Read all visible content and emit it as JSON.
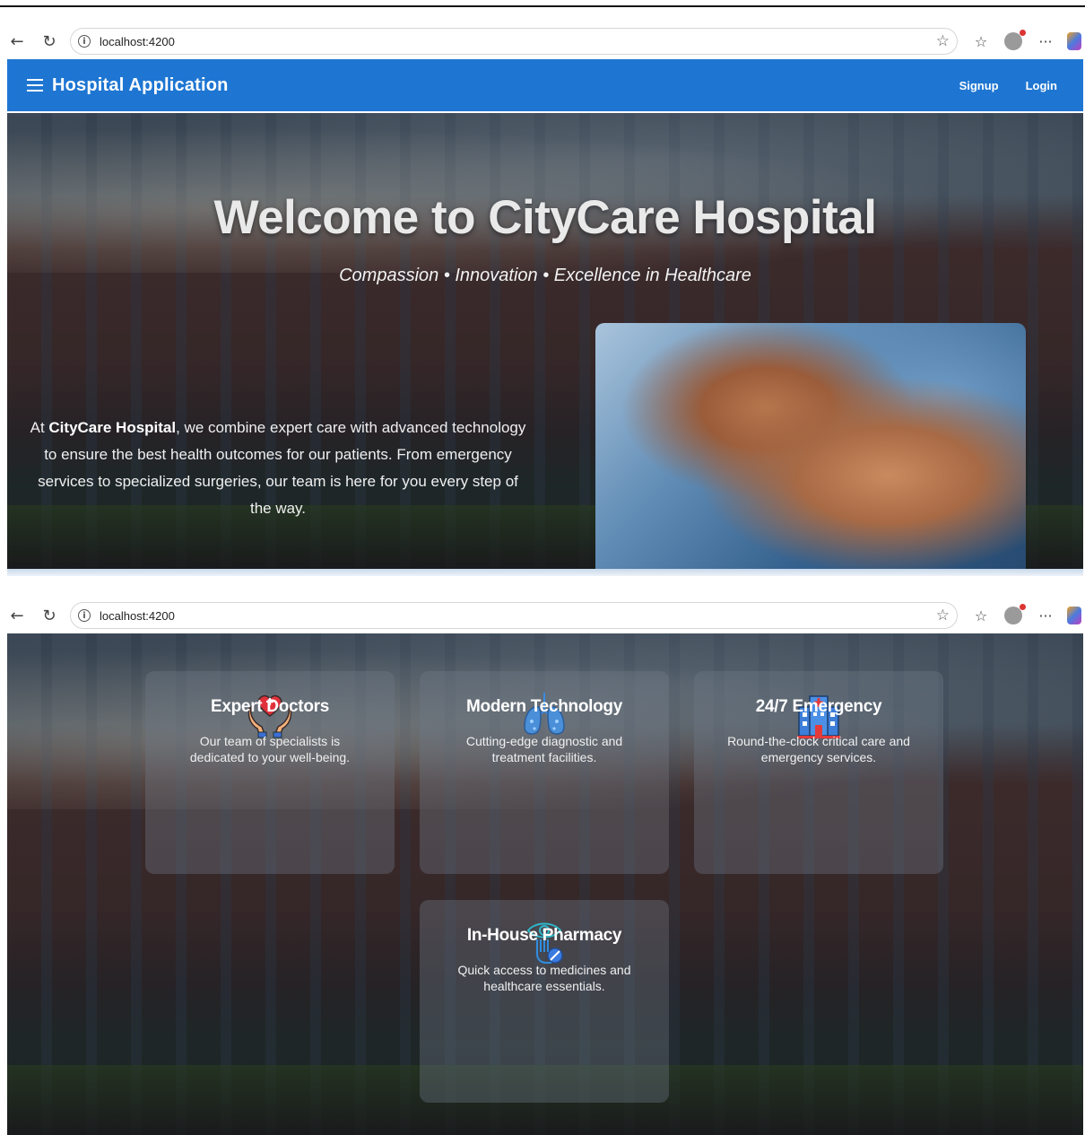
{
  "browser": {
    "url": "localhost:4200",
    "toolbar_icons": [
      "back-icon",
      "reload-icon",
      "info-icon",
      "star-icon",
      "favorites-icon",
      "profile-icon",
      "more-icon",
      "copilot-icon"
    ]
  },
  "toolbar": {
    "title": "Hospital Application",
    "signup_label": "Signup",
    "login_label": "Login",
    "color": "#1e76d2"
  },
  "hero": {
    "title": "Welcome to CityCare Hospital",
    "subtitle": "Compassion • Innovation • Excellence in Healthcare",
    "text_prefix": "At ",
    "text_bold": "CityCare Hospital",
    "text_suffix": ", we combine expert care with advanced technology to ensure the best health outcomes for our patients. From emergency services to specialized surgeries, our team is here for you every step of the way."
  },
  "features": [
    {
      "icon": "heart-hands-icon",
      "title": "Expert Doctors",
      "description": "Our team of specialists is dedicated to your well-being."
    },
    {
      "icon": "lungs-icon",
      "title": "Modern Technology",
      "description": "Cutting-edge diagnostic and treatment facilities."
    },
    {
      "icon": "hospital-building-icon",
      "title": "24/7 Emergency",
      "description": "Round-the-clock critical care and emergency services."
    },
    {
      "icon": "pharmacy-eye-icon",
      "title": "In-House Pharmacy",
      "description": "Quick access to medicines and healthcare essentials."
    }
  ]
}
